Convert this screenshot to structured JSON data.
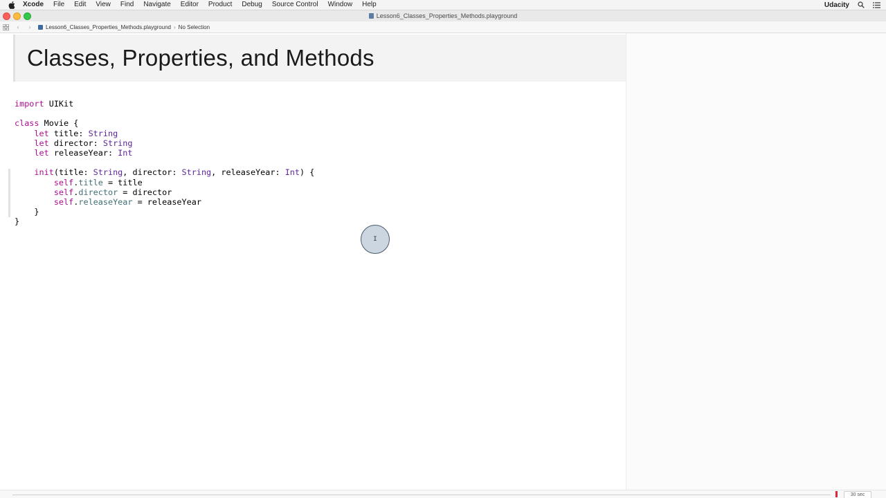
{
  "menubar": {
    "app_name": "Xcode",
    "items": [
      "File",
      "Edit",
      "View",
      "Find",
      "Navigate",
      "Editor",
      "Product",
      "Debug",
      "Source Control",
      "Window",
      "Help"
    ],
    "brand": "Udacity"
  },
  "window": {
    "title": "Lesson6_Classes_Properties_Methods.playground"
  },
  "jumpbar": {
    "file": "Lesson6_Classes_Properties_Methods.playground",
    "selection": "No Selection"
  },
  "markup": {
    "title": "Classes, Properties, and Methods"
  },
  "code_lines": [
    [
      {
        "t": "import",
        "c": "kw"
      },
      {
        "t": " UIKit"
      }
    ],
    [],
    [
      {
        "t": "class",
        "c": "kw"
      },
      {
        "t": " Movie {"
      }
    ],
    [
      {
        "t": "    "
      },
      {
        "t": "let",
        "c": "kw"
      },
      {
        "t": " title: "
      },
      {
        "t": "String",
        "c": "ty"
      }
    ],
    [
      {
        "t": "    "
      },
      {
        "t": "let",
        "c": "kw"
      },
      {
        "t": " director: "
      },
      {
        "t": "String",
        "c": "ty"
      }
    ],
    [
      {
        "t": "    "
      },
      {
        "t": "let",
        "c": "kw"
      },
      {
        "t": " releaseYear: "
      },
      {
        "t": "Int",
        "c": "ty"
      }
    ],
    [],
    [
      {
        "t": "    "
      },
      {
        "t": "init",
        "c": "kw"
      },
      {
        "t": "(title: "
      },
      {
        "t": "String",
        "c": "ty"
      },
      {
        "t": ", director: "
      },
      {
        "t": "String",
        "c": "ty"
      },
      {
        "t": ", releaseYear: "
      },
      {
        "t": "Int",
        "c": "ty"
      },
      {
        "t": ") {"
      }
    ],
    [
      {
        "t": "        "
      },
      {
        "t": "self",
        "c": "kw"
      },
      {
        "t": "."
      },
      {
        "t": "title",
        "c": "pr"
      },
      {
        "t": " = title"
      }
    ],
    [
      {
        "t": "        "
      },
      {
        "t": "self",
        "c": "kw"
      },
      {
        "t": "."
      },
      {
        "t": "director",
        "c": "pr"
      },
      {
        "t": " = director"
      }
    ],
    [
      {
        "t": "        "
      },
      {
        "t": "self",
        "c": "kw"
      },
      {
        "t": "."
      },
      {
        "t": "releaseYear",
        "c": "pr"
      },
      {
        "t": " = releaseYear"
      }
    ],
    [
      {
        "t": "    }"
      }
    ],
    [
      {
        "t": "}"
      }
    ]
  ],
  "timeline": {
    "duration_label": "30 sec"
  },
  "colors": {
    "keyword": "#aa0d91",
    "type": "#5c2699",
    "property": "#3f6e74"
  },
  "icons": {
    "apple": "apple-logo-icon",
    "search": "spotlight-search-icon",
    "list": "notification-center-icon",
    "grid": "related-items-grid-icon",
    "back": "chevron-left-icon",
    "forward": "chevron-right-icon"
  }
}
